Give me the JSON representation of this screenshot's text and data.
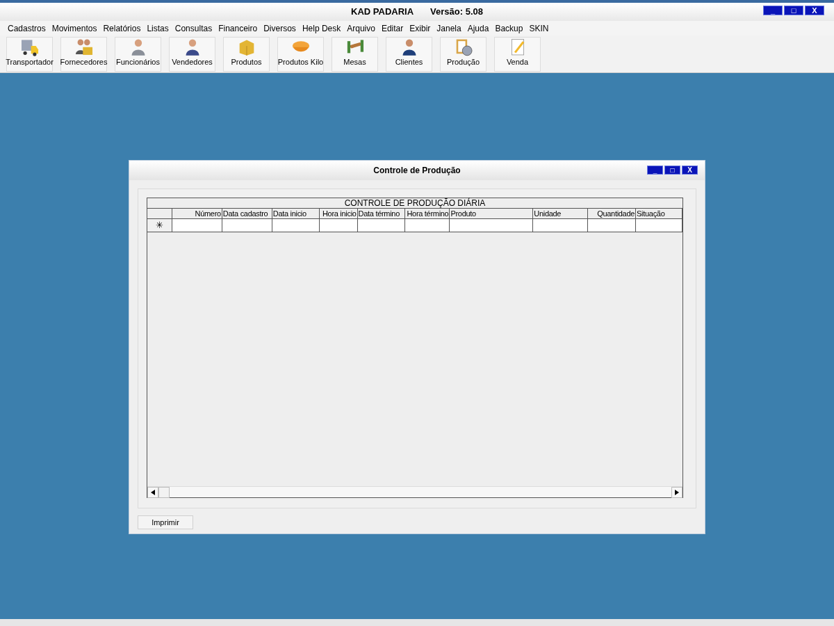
{
  "window": {
    "title": "KAD PADARIA",
    "version": "Versão: 5.08",
    "controls": [
      "_",
      "□",
      "X"
    ]
  },
  "menu": [
    "Cadastros",
    "Movimentos",
    "Relatórios",
    "Listas",
    "Consultas",
    "Financeiro",
    "Diversos",
    "Help Desk",
    "Arquivo",
    "Editar",
    "Exibir",
    "Janela",
    "Ajuda",
    "Backup",
    "SKIN"
  ],
  "toolbar": [
    {
      "label": "Transportador"
    },
    {
      "label": "Fornecedores"
    },
    {
      "label": "Funcionários"
    },
    {
      "label": "Vendedores"
    },
    {
      "label": "Produtos"
    },
    {
      "label": "Produtos Kilo"
    },
    {
      "label": "Mesas"
    },
    {
      "label": "Clientes"
    },
    {
      "label": "Produção"
    },
    {
      "label": "Venda"
    }
  ],
  "child_window": {
    "title": "Controle de Produção",
    "controls": [
      "_",
      "□",
      "X"
    ],
    "grid": {
      "caption": "CONTROLE DE PRODUÇÃO DIÁRIA",
      "columns": [
        {
          "label": "Número"
        },
        {
          "label": "Data cadastro"
        },
        {
          "label": "Data inicio"
        },
        {
          "label": "Hora inicio"
        },
        {
          "label": "Data término"
        },
        {
          "label": "Hora término"
        },
        {
          "label": "Produto"
        },
        {
          "label": "Unidade"
        },
        {
          "label": "Quantidade"
        },
        {
          "label": "Situação"
        }
      ],
      "new_row_marker": "✳"
    },
    "buttons": [
      "Imprimir"
    ]
  }
}
